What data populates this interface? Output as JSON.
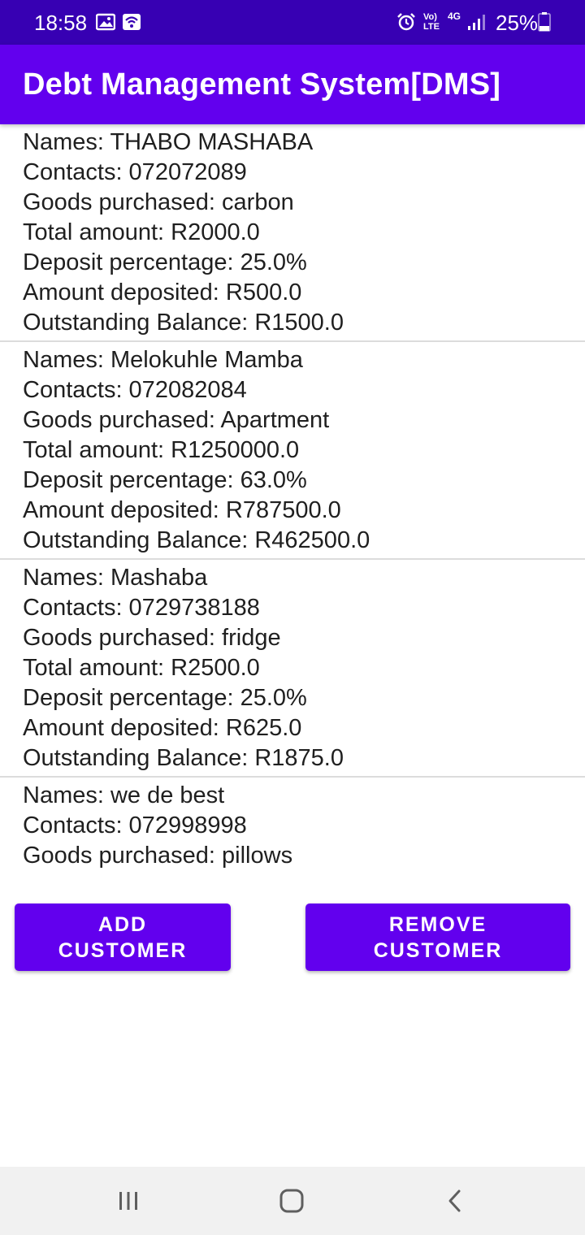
{
  "status_bar": {
    "time": "18:58",
    "battery": "25%",
    "network": "4G",
    "volte": "Vo) LTE",
    "icons": [
      "gallery-icon",
      "wifi-hotspot-icon",
      "alarm-icon",
      "volte-icon",
      "network-4g-icon",
      "signal-icon",
      "battery-icon"
    ]
  },
  "app_bar": {
    "title": "Debt Management System[DMS]",
    "color": "#6200ee",
    "status_color": "#3700b3"
  },
  "customers": [
    {
      "names": "Names: THABO MASHABA",
      "contacts": "Contacts: 072072089",
      "goods": "Goods purchased: carbon",
      "total": "Total amount: R2000.0",
      "deposit_pct": "Deposit percentage: 25.0%",
      "deposited": "Amount deposited: R500.0",
      "balance": "Outstanding Balance: R1500.0"
    },
    {
      "names": "Names: Melokuhle Mamba",
      "contacts": "Contacts: 072082084",
      "goods": "Goods purchased: Apartment",
      "total": "Total amount: R1250000.0",
      "deposit_pct": "Deposit percentage: 63.0%",
      "deposited": "Amount deposited: R787500.0",
      "balance": "Outstanding Balance: R462500.0"
    },
    {
      "names": "Names: Mashaba",
      "contacts": "Contacts: 0729738188",
      "goods": "Goods purchased: fridge",
      "total": "Total amount: R2500.0",
      "deposit_pct": "Deposit percentage: 25.0%",
      "deposited": "Amount deposited: R625.0",
      "balance": "Outstanding Balance: R1875.0"
    },
    {
      "names": "Names: we de best",
      "contacts": "Contacts: 072998998",
      "goods": "Goods purchased: pillows"
    }
  ],
  "buttons": {
    "add_line1": "ADD",
    "add_line2": "CUSTOMER",
    "remove_line1": "REMOVE",
    "remove_line2": "CUSTOMER"
  },
  "nav_bar": {
    "icons": [
      "recent-apps-icon",
      "home-icon",
      "back-icon"
    ]
  }
}
